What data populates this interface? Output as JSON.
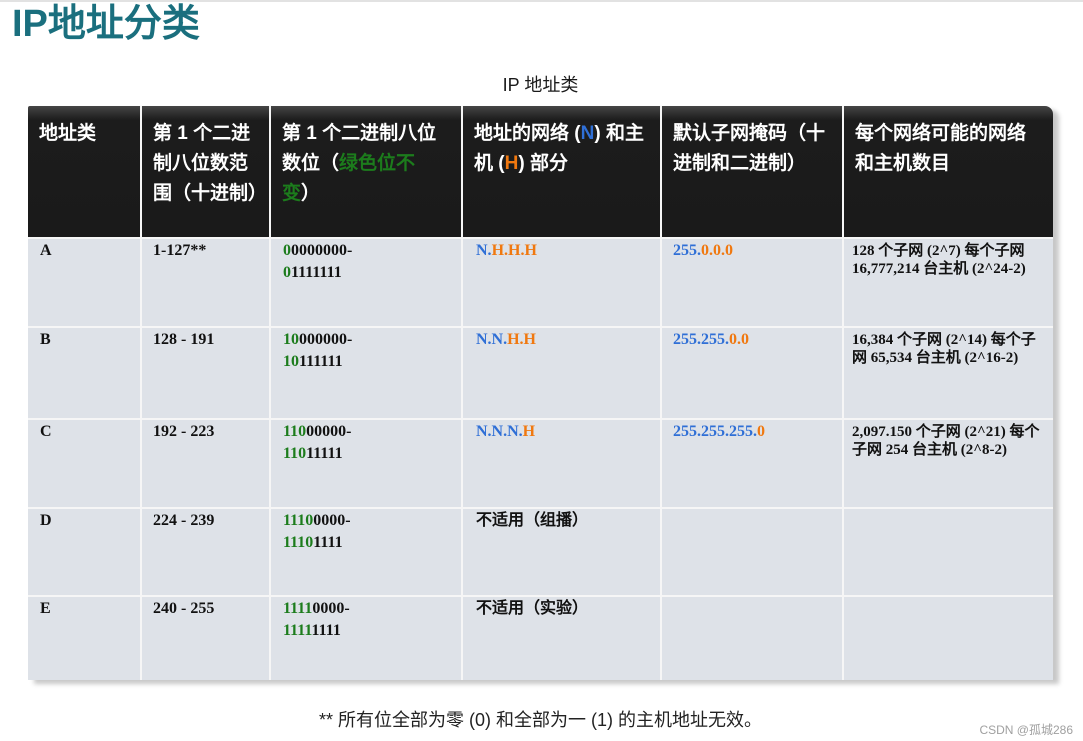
{
  "title": "IP地址分类",
  "table": {
    "caption": "IP 地址类",
    "header": {
      "class": "地址类",
      "range": "第 1 个二进制八位数范围（十进制）",
      "bits": {
        "pre": "第 1 个二进制八位数位（",
        "fixed_note": "绿色位不变",
        "post": "）"
      },
      "parts": {
        "pre": "地址的网络 (",
        "network": "N",
        "mid": ") 和主机 (",
        "host": "H",
        "post": ") 部分"
      },
      "mask": "默认子网掩码（十进制和二进制）",
      "hosts": "每个网络可能的网络和主机数目"
    },
    "rows": [
      {
        "class": "A",
        "range": "1-127**",
        "bits_from": {
          "fixed": "0",
          "rest": "0000000-"
        },
        "bits_to": {
          "fixed": "0",
          "rest": "1111111"
        },
        "parts": {
          "network": "N.",
          "host": "H.H.H"
        },
        "mask": {
          "network": "255.",
          "host": "0.0.0"
        },
        "hosts": "128 个子网 (2^7) 每个子网 16,777,214 台主机 (2^24-2)"
      },
      {
        "class": "B",
        "range": "128 - 191",
        "bits_from": {
          "fixed": "10",
          "rest": "000000-"
        },
        "bits_to": {
          "fixed": "10",
          "rest": "111111"
        },
        "parts": {
          "network": "N.N.",
          "host": "H.H"
        },
        "mask": {
          "network": "255.255.",
          "host": "0.0"
        },
        "hosts": "16,384 个子网 (2^14) 每个子网 65,534 台主机 (2^16-2)"
      },
      {
        "class": "C",
        "range": "192 - 223",
        "bits_from": {
          "fixed": "110",
          "rest": "00000-"
        },
        "bits_to": {
          "fixed": "110",
          "rest": "11111"
        },
        "parts": {
          "network": "N.N.N.",
          "host": "H"
        },
        "mask": {
          "network": "255.255.255.",
          "host": "0"
        },
        "hosts": "2,097.150 个子网 (2^21) 每个子网 254 台主机 (2^8-2)"
      },
      {
        "class": "D",
        "range": "224 - 239",
        "bits_from": {
          "fixed": "1110",
          "rest": "0000-"
        },
        "bits_to": {
          "fixed": "1110",
          "rest": "1111"
        },
        "parts": {
          "note": "不适用（组播）"
        }
      },
      {
        "class": "E",
        "range": "240 - 255",
        "bits_from": {
          "fixed": "1111",
          "rest": "0000-"
        },
        "bits_to": {
          "fixed": "1111",
          "rest": "1111"
        },
        "parts": {
          "note": "不适用（实验）"
        }
      }
    ]
  },
  "footnote": "** 所有位全部为零 (0) 和全部为一 (1) 的主机地址无效。",
  "watermark": "CSDN @孤城286",
  "colors": {
    "title": "#1a6f7e",
    "header_bg": "#1a1a1a",
    "cell_bg": "#dee2e8",
    "fixed_bits": "#1c7c1c",
    "network": "#2f6fd6",
    "host": "#f0780f"
  }
}
